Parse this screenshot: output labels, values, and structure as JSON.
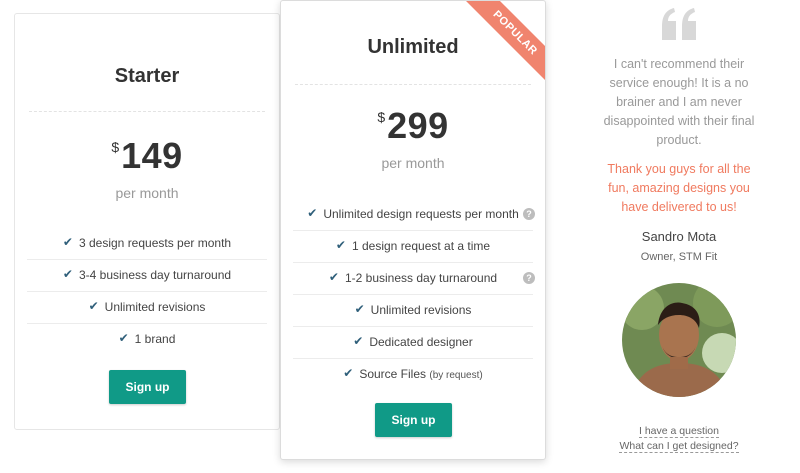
{
  "plans": [
    {
      "title": "Starter",
      "currency": "$",
      "amount": "149",
      "period": "per month",
      "features": [
        "3 design requests per month",
        "3-4 business day turnaround",
        "Unlimited revisions",
        "1 brand"
      ],
      "cta": "Sign up"
    },
    {
      "title": "Unlimited",
      "badge": "POPULAR",
      "currency": "$",
      "amount": "299",
      "period": "per month",
      "features": [
        "Unlimited design requests per month",
        "1 design request at a time",
        "1-2 business day turnaround",
        "Unlimited revisions",
        "Dedicated designer",
        "Source Files"
      ],
      "feature_note": "(by request)",
      "help_marker": "?",
      "cta": "Sign up"
    }
  ],
  "testimonial": {
    "quote": "I can't recommend their service enough! It is a no brainer and I am never disappointed with their final product.",
    "highlight": "Thank you guys for all the fun, amazing designs you have delivered to us!",
    "author": "Sandro Mota",
    "role": "Owner, STM Fit"
  },
  "links": {
    "question": "I have a question",
    "designed": "What can I get designed?"
  },
  "colors": {
    "accent": "#109a87",
    "ribbon": "#f0846e",
    "highlight_text": "#f07a5f"
  }
}
